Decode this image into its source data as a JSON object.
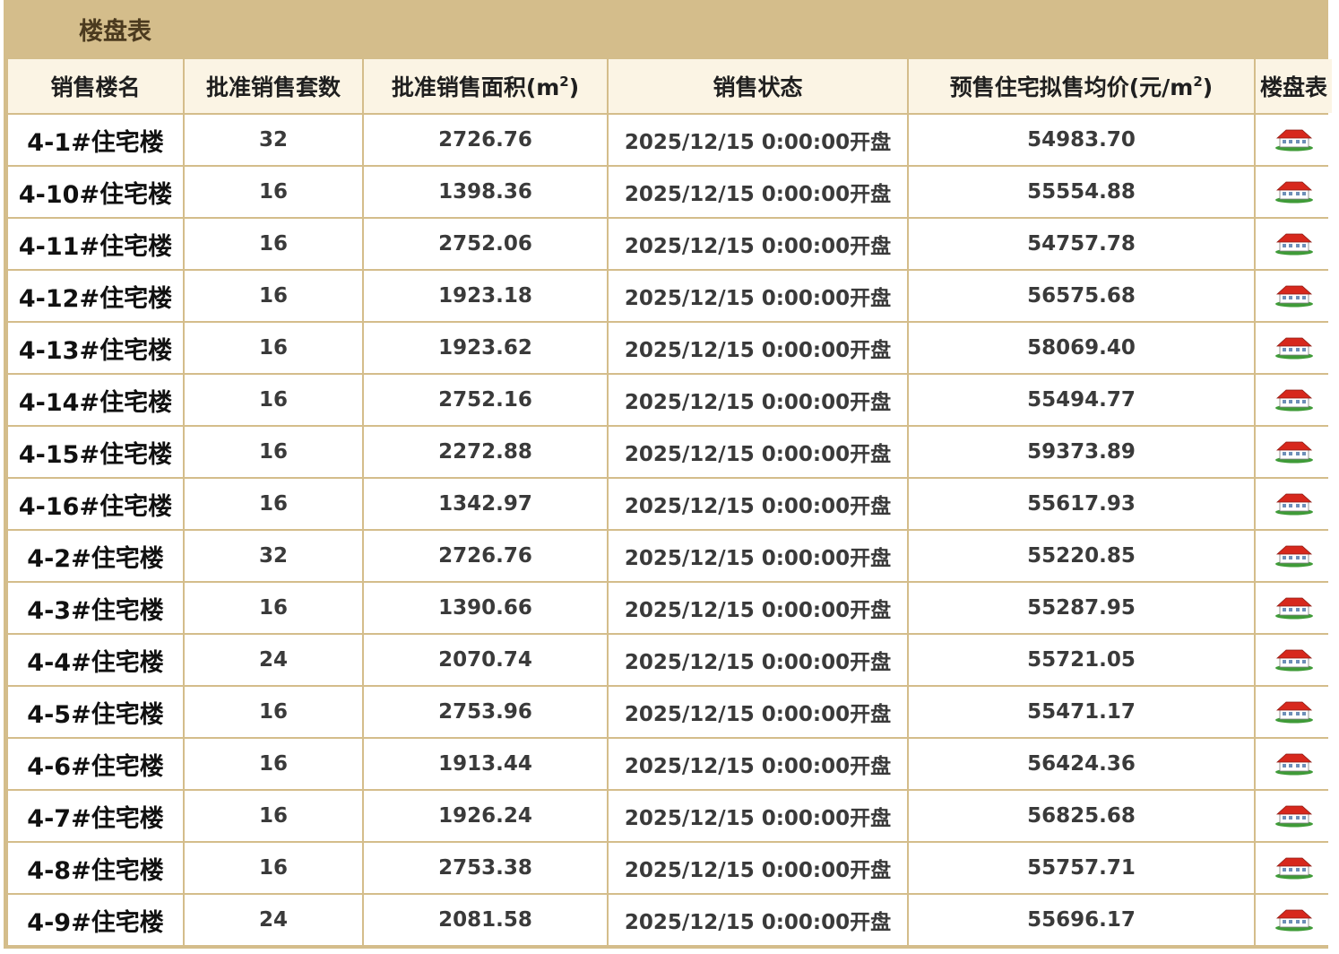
{
  "panel": {
    "title": "楼盘表"
  },
  "table": {
    "headers": {
      "name": "销售楼名",
      "units": "批准销售套数",
      "area": "批准销售面积(m",
      "area_sup": "2",
      "area_close": ")",
      "status": "销售状态",
      "price": "预售住宅拟售均价(元/m",
      "price_sup": "2",
      "price_close": ")",
      "plan": "楼盘表"
    },
    "rows": [
      {
        "name": "4-1#住宅楼",
        "units": "32",
        "area": "2726.76",
        "status": "2025/12/15 0:00:00开盘",
        "price": "54983.70",
        "icon": "house-icon"
      },
      {
        "name": "4-10#住宅楼",
        "units": "16",
        "area": "1398.36",
        "status": "2025/12/15 0:00:00开盘",
        "price": "55554.88",
        "icon": "house-icon"
      },
      {
        "name": "4-11#住宅楼",
        "units": "16",
        "area": "2752.06",
        "status": "2025/12/15 0:00:00开盘",
        "price": "54757.78",
        "icon": "house-icon"
      },
      {
        "name": "4-12#住宅楼",
        "units": "16",
        "area": "1923.18",
        "status": "2025/12/15 0:00:00开盘",
        "price": "56575.68",
        "icon": "house-icon"
      },
      {
        "name": "4-13#住宅楼",
        "units": "16",
        "area": "1923.62",
        "status": "2025/12/15 0:00:00开盘",
        "price": "58069.40",
        "icon": "house-icon"
      },
      {
        "name": "4-14#住宅楼",
        "units": "16",
        "area": "2752.16",
        "status": "2025/12/15 0:00:00开盘",
        "price": "55494.77",
        "icon": "house-icon"
      },
      {
        "name": "4-15#住宅楼",
        "units": "16",
        "area": "2272.88",
        "status": "2025/12/15 0:00:00开盘",
        "price": "59373.89",
        "icon": "house-icon"
      },
      {
        "name": "4-16#住宅楼",
        "units": "16",
        "area": "1342.97",
        "status": "2025/12/15 0:00:00开盘",
        "price": "55617.93",
        "icon": "house-icon"
      },
      {
        "name": "4-2#住宅楼",
        "units": "32",
        "area": "2726.76",
        "status": "2025/12/15 0:00:00开盘",
        "price": "55220.85",
        "icon": "house-icon"
      },
      {
        "name": "4-3#住宅楼",
        "units": "16",
        "area": "1390.66",
        "status": "2025/12/15 0:00:00开盘",
        "price": "55287.95",
        "icon": "house-icon"
      },
      {
        "name": "4-4#住宅楼",
        "units": "24",
        "area": "2070.74",
        "status": "2025/12/15 0:00:00开盘",
        "price": "55721.05",
        "icon": "house-icon"
      },
      {
        "name": "4-5#住宅楼",
        "units": "16",
        "area": "2753.96",
        "status": "2025/12/15 0:00:00开盘",
        "price": "55471.17",
        "icon": "house-icon"
      },
      {
        "name": "4-6#住宅楼",
        "units": "16",
        "area": "1913.44",
        "status": "2025/12/15 0:00:00开盘",
        "price": "56424.36",
        "icon": "house-icon"
      },
      {
        "name": "4-7#住宅楼",
        "units": "16",
        "area": "1926.24",
        "status": "2025/12/15 0:00:00开盘",
        "price": "56825.68",
        "icon": "house-icon"
      },
      {
        "name": "4-8#住宅楼",
        "units": "16",
        "area": "2753.38",
        "status": "2025/12/15 0:00:00开盘",
        "price": "55757.71",
        "icon": "house-icon"
      },
      {
        "name": "4-9#住宅楼",
        "units": "24",
        "area": "2081.58",
        "status": "2025/12/15 0:00:00开盘",
        "price": "55696.17",
        "icon": "house-icon"
      }
    ]
  },
  "colors": {
    "panel_bg": "#d4bd8b",
    "header_bg": "#fbf4e4",
    "cell_bg": "#ffffff",
    "icon_roof": "#d7281d",
    "icon_wall": "#ffffff",
    "icon_grass": "#3f9b38"
  }
}
